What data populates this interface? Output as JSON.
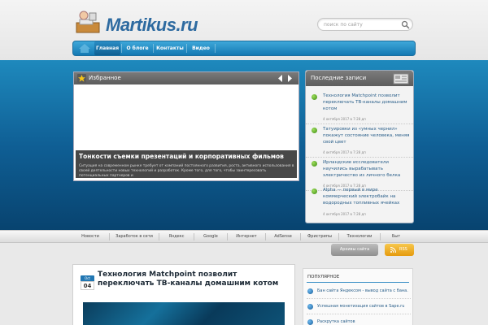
{
  "header": {
    "logo_text": "Martikus.ru",
    "search_placeholder": "поиск по сайту"
  },
  "nav": {
    "items": [
      {
        "label": "Главная"
      },
      {
        "label": "О блоге"
      },
      {
        "label": "Контакты"
      },
      {
        "label": "Видео"
      }
    ]
  },
  "featured": {
    "heading": "Избранное",
    "caption_title": "Тонкости съемки презентаций и корпоративных фильмов",
    "caption_text": "Ситуация на современном рынке требует от компаний постоянного развития, роста, активного использования в своей деятельности новых технологий и разработок. Кроме того, для того, чтобы заинтересовать потенциальных партнеров и"
  },
  "recent": {
    "heading": "Последние записи",
    "posts": [
      {
        "title": "Технология Matchpoint позволит переключать ТВ-каналы домашним котом",
        "date": "4 октября 2017 в 7:28 дп"
      },
      {
        "title": "Татуировки из «умных чернил» покажут состояние человека, меняя свой цвет",
        "date": "4 октября 2017 в 7:28 дп"
      },
      {
        "title": "Ирландские исследователи научились вырабатывать электричество из личного белка",
        "date": "4 октября 2017 в 7:28 дп"
      },
      {
        "title": "Alpha — первый в мире коммерческий электробайк на водородных топливных ячейках",
        "date": "4 октября 2017 в 7:28 дп"
      }
    ]
  },
  "categories": [
    "Новости",
    "Заработок в сети",
    "Яндекс",
    "Google",
    "Интернет",
    "AdSense",
    "Фристрипы",
    "Технологии",
    "Быт"
  ],
  "subscribe_label": "Архивы сайта",
  "rss_label": "RSS",
  "article": {
    "month": "Oct",
    "day": "04",
    "title": "Технология Matchpoint позволит переключать ТВ-каналы домашним котом"
  },
  "popular": {
    "heading": "ПОПУЛЯРНОЕ",
    "items": [
      {
        "label": "Бан сайта Яндексом - вывод сайта с бана."
      },
      {
        "label": "Успешная монетизация сайтов в Sape.ru"
      },
      {
        "label": "Раскрутка сайтов"
      }
    ]
  },
  "colors": {
    "accent_blue": "#1379b3",
    "band_blue": "#0f5f95",
    "bullet_green": "#3f8d14",
    "rss_orange": "#e59a0e"
  }
}
